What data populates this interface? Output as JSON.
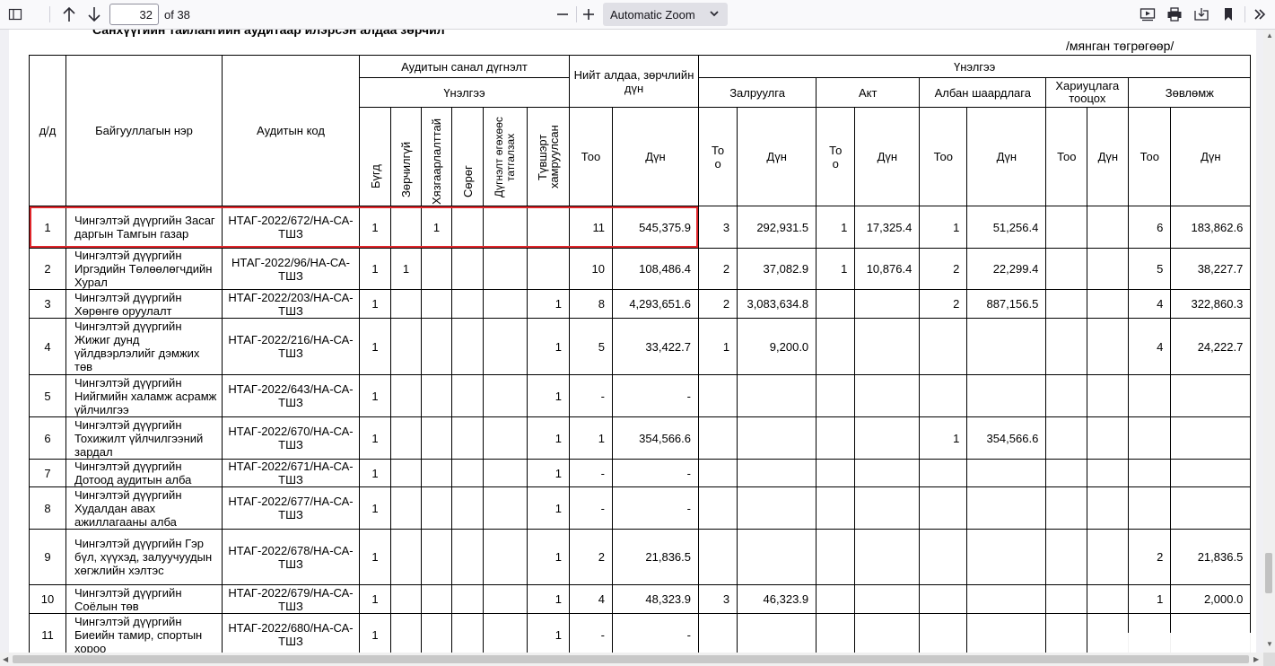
{
  "toolbar": {
    "page_number": "32",
    "page_count": "of 38",
    "zoom": "Automatic Zoom"
  },
  "doc": {
    "heading": "Санхүүгийн тайлангийн аудитаар илэрсэн алдаа зөрчил",
    "unit": "/мянган төгрөгөөр/"
  },
  "headers": {
    "no": "д/д",
    "org": "Байгууллагын нэр",
    "code": "Аудитын код",
    "opinion": "Аудитын санал дүгнэлт",
    "assessment": "Үнэлгээ",
    "total": "Нийт алдаа, зөрчлийн дүн",
    "assessment2": "Үнэлгээ",
    "correction": "Залруулга",
    "act": "Акт",
    "demand": "Албан шаардлага",
    "liability": "Хариуцлага тооцох",
    "recommendation": "Зөвлөмж",
    "bugd": "Бүгд",
    "zorchilgui": "Зөрчилгүй",
    "hyazgaarlalttai": "Хязгаарлалттай",
    "soreg": "Сөрөг",
    "tatgalzah": "Дүгнэлт өгөхөөс татгалзах",
    "tuvshin": "Түвшэрт хамруулсан",
    "too": "Тоо",
    "dun": "Дүн",
    "to_o": "То о"
  },
  "rows": [
    {
      "no": "1",
      "org": "Чингэлтэй дүүргийн Засаг даргын Тамгын газар",
      "code": "НТАГ-2022/672/НА-СА-ТШЗ",
      "bugd": "1",
      "zorchilgui": "",
      "hyaz": "1",
      "soreg": "",
      "tatg": "",
      "tuv": "",
      "total_n": "11",
      "total_v": "545,375.9",
      "corr_n": "3",
      "corr_v": "292,931.5",
      "act_n": "1",
      "act_v": "17,325.4",
      "dem_n": "1",
      "dem_v": "51,256.4",
      "liab_n": "",
      "liab_v": "",
      "rec_n": "6",
      "rec_v": "183,862.6"
    },
    {
      "no": "2",
      "org": "Чингэлтэй дүүргийн Иргэдийн Төлөөлөгчдийн Хурал",
      "code": "НТАГ-2022/96/НА-СА-ТШЗ",
      "bugd": "1",
      "zorchilgui": "1",
      "hyaz": "",
      "soreg": "",
      "tatg": "",
      "tuv": "",
      "total_n": "10",
      "total_v": "108,486.4",
      "corr_n": "2",
      "corr_v": "37,082.9",
      "act_n": "1",
      "act_v": "10,876.4",
      "dem_n": "2",
      "dem_v": "22,299.4",
      "liab_n": "",
      "liab_v": "",
      "rec_n": "5",
      "rec_v": "38,227.7"
    },
    {
      "no": "3",
      "org": "Чингэлтэй дүүргийн Хөрөнгө оруулалт",
      "code": "НТАГ-2022/203/НА-СА-ТШЗ",
      "bugd": "1",
      "zorchilgui": "",
      "hyaz": "",
      "soreg": "",
      "tatg": "",
      "tuv": "1",
      "total_n": "8",
      "total_v": "4,293,651.6",
      "corr_n": "2",
      "corr_v": "3,083,634.8",
      "act_n": "",
      "act_v": "",
      "dem_n": "2",
      "dem_v": "887,156.5",
      "liab_n": "",
      "liab_v": "",
      "rec_n": "4",
      "rec_v": "322,860.3"
    },
    {
      "no": "4",
      "org": "Чингэлтэй дүүргийн Жижиг дунд үйлдвэрлэлийг дэмжих төв",
      "code": "НТАГ-2022/216/НА-СА-ТШЗ",
      "bugd": "1",
      "zorchilgui": "",
      "hyaz": "",
      "soreg": "",
      "tatg": "",
      "tuv": "1",
      "total_n": "5",
      "total_v": "33,422.7",
      "corr_n": "1",
      "corr_v": "9,200.0",
      "act_n": "",
      "act_v": "",
      "dem_n": "",
      "dem_v": "",
      "liab_n": "",
      "liab_v": "",
      "rec_n": "4",
      "rec_v": "24,222.7"
    },
    {
      "no": "5",
      "org": "Чингэлтэй дүүргийн Нийгмийн халамж асрамж үйлчилгээ",
      "code": "НТАГ-2022/643/НА-СА-ТШЗ",
      "bugd": "1",
      "zorchilgui": "",
      "hyaz": "",
      "soreg": "",
      "tatg": "",
      "tuv": "1",
      "total_n": "-",
      "total_v": "-",
      "corr_n": "",
      "corr_v": "",
      "act_n": "",
      "act_v": "",
      "dem_n": "",
      "dem_v": "",
      "liab_n": "",
      "liab_v": "",
      "rec_n": "",
      "rec_v": ""
    },
    {
      "no": "6",
      "org": "Чингэлтэй дүүргийн Тохижилт үйлчилгээний зардал",
      "code": "НТАГ-2022/670/НА-СА-ТШЗ",
      "bugd": "1",
      "zorchilgui": "",
      "hyaz": "",
      "soreg": "",
      "tatg": "",
      "tuv": "1",
      "total_n": "1",
      "total_v": "354,566.6",
      "corr_n": "",
      "corr_v": "",
      "act_n": "",
      "act_v": "",
      "dem_n": "1",
      "dem_v": "354,566.6",
      "liab_n": "",
      "liab_v": "",
      "rec_n": "",
      "rec_v": ""
    },
    {
      "no": "7",
      "org": "Чингэлтэй дүүргийн Дотоод аудитын алба",
      "code": "НТАГ-2022/671/НА-СА-ТШЗ",
      "bugd": "1",
      "zorchilgui": "",
      "hyaz": "",
      "soreg": "",
      "tatg": "",
      "tuv": "1",
      "total_n": "-",
      "total_v": "-",
      "corr_n": "",
      "corr_v": "",
      "act_n": "",
      "act_v": "",
      "dem_n": "",
      "dem_v": "",
      "liab_n": "",
      "liab_v": "",
      "rec_n": "",
      "rec_v": ""
    },
    {
      "no": "8",
      "org": "Чингэлтэй дүүргийн Худалдан авах ажиллагааны алба",
      "code": "НТАГ-2022/677/НА-СА-ТШЗ",
      "bugd": "1",
      "zorchilgui": "",
      "hyaz": "",
      "soreg": "",
      "tatg": "",
      "tuv": "1",
      "total_n": "-",
      "total_v": "-",
      "corr_n": "",
      "corr_v": "",
      "act_n": "",
      "act_v": "",
      "dem_n": "",
      "dem_v": "",
      "liab_n": "",
      "liab_v": "",
      "rec_n": "",
      "rec_v": ""
    },
    {
      "no": "9",
      "org": "Чингэлтэй дүүргийн Гэр бүл, хүүхэд, залуучуудын хөгжлийн хэлтэс",
      "code": "НТАГ-2022/678/НА-СА-ТШЗ",
      "bugd": "1",
      "zorchilgui": "",
      "hyaz": "",
      "soreg": "",
      "tatg": "",
      "tuv": "1",
      "total_n": "2",
      "total_v": "21,836.5",
      "corr_n": "",
      "corr_v": "",
      "act_n": "",
      "act_v": "",
      "dem_n": "",
      "dem_v": "",
      "liab_n": "",
      "liab_v": "",
      "rec_n": "2",
      "rec_v": "21,836.5"
    },
    {
      "no": "10",
      "org": "Чингэлтэй дүүргийн Соёлын төв",
      "code": "НТАГ-2022/679/НА-СА-ТШЗ",
      "bugd": "1",
      "zorchilgui": "",
      "hyaz": "",
      "soreg": "",
      "tatg": "",
      "tuv": "1",
      "total_n": "4",
      "total_v": "48,323.9",
      "corr_n": "3",
      "corr_v": "46,323.9",
      "act_n": "",
      "act_v": "",
      "dem_n": "",
      "dem_v": "",
      "liab_n": "",
      "liab_v": "",
      "rec_n": "1",
      "rec_v": "2,000.0"
    },
    {
      "no": "11",
      "org": "Чингэлтэй дүүргийн Биеийн тамир, спортын хороо",
      "code": "НТАГ-2022/680/НА-СА-ТШЗ",
      "bugd": "1",
      "zorchilgui": "",
      "hyaz": "",
      "soreg": "",
      "tatg": "",
      "tuv": "1",
      "total_n": "-",
      "total_v": "-",
      "corr_n": "",
      "corr_v": "",
      "act_n": "",
      "act_v": "",
      "dem_n": "",
      "dem_v": "",
      "liab_n": "",
      "liab_v": "",
      "rec_n": "",
      "rec_v": ""
    }
  ]
}
